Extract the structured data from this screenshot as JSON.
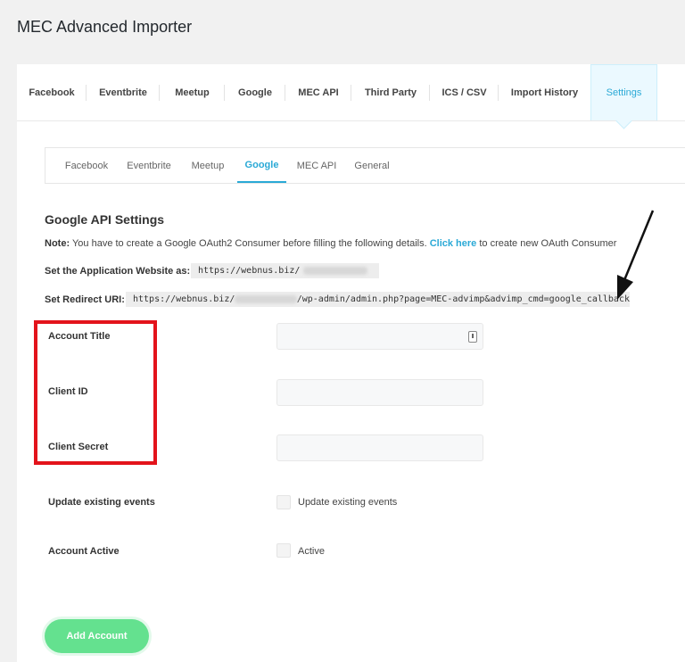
{
  "page_title": "MEC Advanced Importer",
  "main_tabs": [
    "Facebook",
    "Eventbrite",
    "Meetup",
    "Google",
    "MEC API",
    "Third Party",
    "ICS / CSV",
    "Import History",
    "Settings"
  ],
  "sub_tabs": [
    "Facebook",
    "Eventbrite",
    "Meetup",
    "Google",
    "MEC API",
    "General"
  ],
  "section_title": "Google API Settings",
  "note": {
    "label": "Note:",
    "text": "You have to create a Google OAuth2 Consumer before filling the following details.",
    "link": "Click here",
    "suffix": "to create new OAuth Consumer"
  },
  "app_website": {
    "label": "Set the Application Website as:",
    "value": "https://webnus.biz/"
  },
  "redirect_uri": {
    "label": "Set Redirect URI:",
    "value_prefix": "https://webnus.biz/",
    "value_suffix": "/wp-admin/admin.php?page=MEC-advimp&advimp_cmd=google_callback"
  },
  "fields": {
    "account_title": "Account Title",
    "client_id": "Client ID",
    "client_secret": "Client Secret",
    "update_existing": "Update existing events",
    "update_existing_check": "Update existing events",
    "account_active": "Account Active",
    "active_check": "Active"
  },
  "add_button": "Add Account",
  "colors": {
    "accent": "#2aa9d6",
    "button": "#64e18f",
    "highlight": "#e3131b"
  }
}
